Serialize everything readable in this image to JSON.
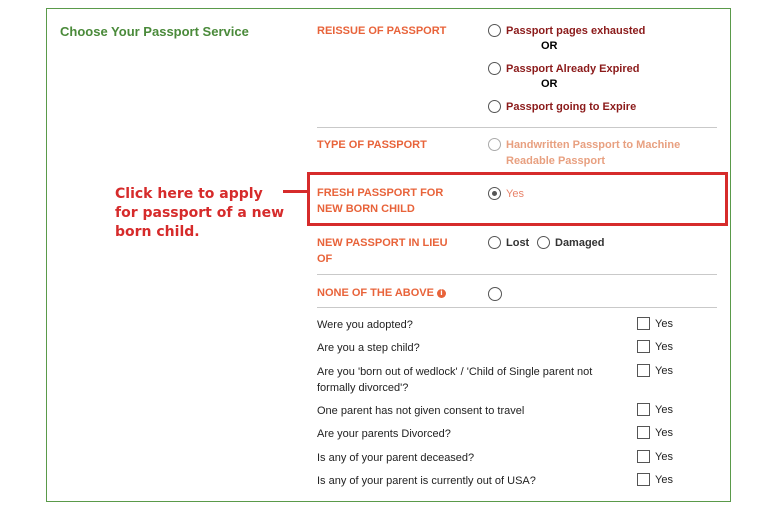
{
  "panel": {
    "title": "Choose Your Passport Service"
  },
  "reissue": {
    "label": "REISSUE OF PASSPORT",
    "options": [
      "Passport pages exhausted",
      "Passport Already Expired",
      "Passport going to Expire"
    ],
    "or_text": "OR"
  },
  "type_of_passport": {
    "label": "TYPE OF PASSPORT",
    "option_line1": "Handwritten Passport to Machine",
    "option_line2": "Readable Passport"
  },
  "fresh": {
    "label_line1": "FRESH PASSPORT FOR",
    "label_line2": "NEW BORN CHILD",
    "option": "Yes",
    "selected": true
  },
  "in_lieu": {
    "label_line1": "NEW PASSPORT IN LIEU",
    "label_line2": "OF",
    "option_lost": "Lost",
    "option_damaged": "Damaged"
  },
  "none": {
    "label": "NONE OF THE ABOVE",
    "info_icon": "info-icon"
  },
  "questions": [
    {
      "text": "Were you adopted?",
      "check": "Yes"
    },
    {
      "text": "Are you a step child?",
      "check": "Yes"
    },
    {
      "text": "Are you 'born out of wedlock' / 'Child of Single parent not formally divorced'?",
      "check": "Yes"
    },
    {
      "text": "One parent has not given consent to travel",
      "check": "Yes"
    },
    {
      "text": "Are your parents Divorced?",
      "check": "Yes"
    },
    {
      "text": "Is any of your parent deceased?",
      "check": "Yes"
    },
    {
      "text": "Is any of your parent is currently out of USA?",
      "check": "Yes"
    }
  ],
  "annotation": {
    "text": "Click here to apply for passport of a new born child."
  },
  "colors": {
    "accent": "#e8633a",
    "title_green": "#4a8a3a",
    "highlight_red": "#d62b2b",
    "option_text": "#8b1a1a"
  }
}
